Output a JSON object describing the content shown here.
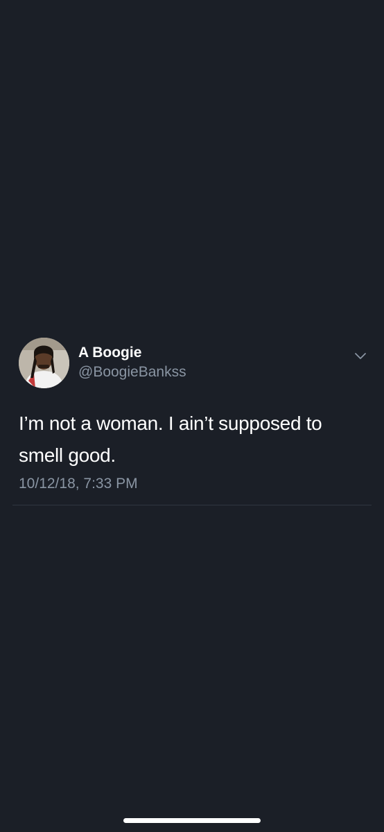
{
  "tweet": {
    "display_name": "A Boogie",
    "handle": "@BoogieBankss",
    "text": "I’m not a woman. I ain’t supposed to smell good.",
    "timestamp": "10/12/18, 7:33 PM",
    "menu_icon": "chevron-down-icon",
    "avatar_icon": "avatar"
  },
  "colors": {
    "background": "#1b1f27",
    "primary_text": "#ffffff",
    "secondary_text": "#8a95a3",
    "divider": "#2f3641"
  }
}
